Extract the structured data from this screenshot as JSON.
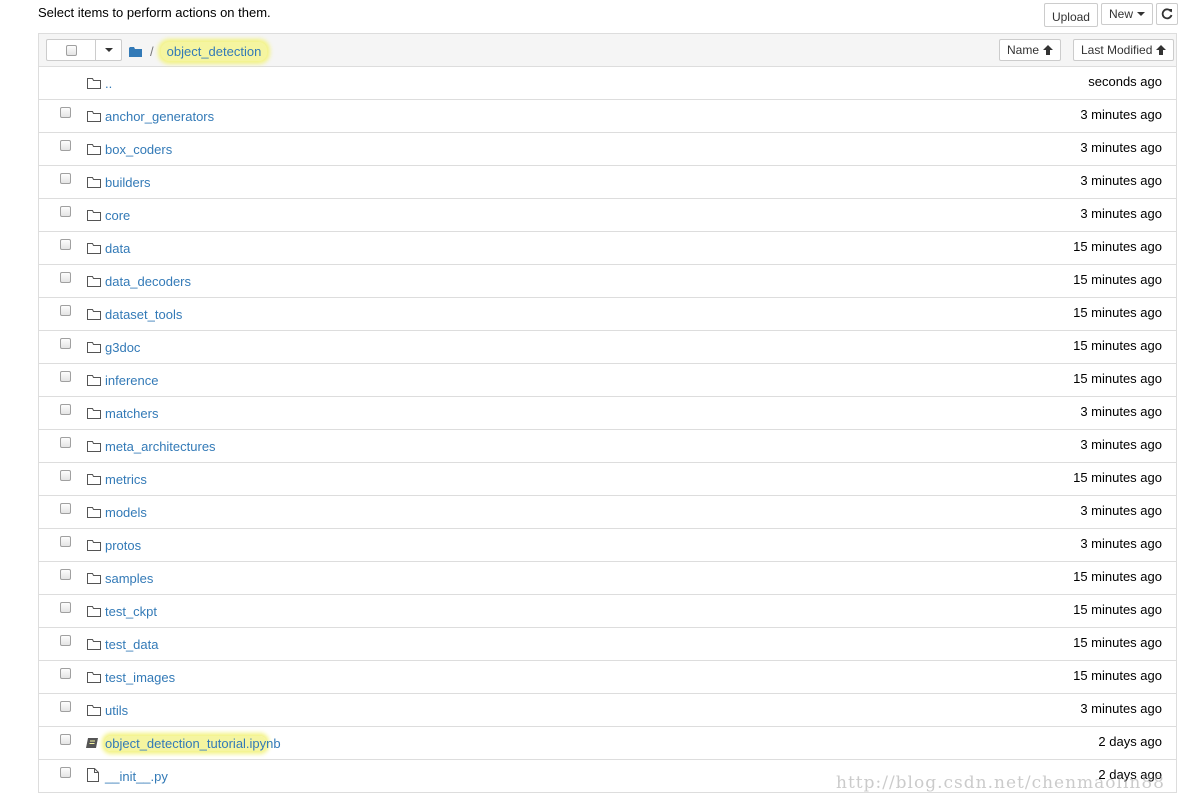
{
  "instructions": "Select items to perform actions on them.",
  "toolbar": {
    "upload_label": "Upload",
    "new_label": "New",
    "refresh_icon": "refresh-icon"
  },
  "header": {
    "breadcrumb_root_icon": "folder-icon",
    "breadcrumb_sep": "/",
    "breadcrumb_current": "object_detection",
    "sort_name_label": "Name",
    "sort_modified_label": "Last Modified"
  },
  "items": [
    {
      "name": "..",
      "time": "seconds ago",
      "type": "folder",
      "checkbox": false
    },
    {
      "name": "anchor_generators",
      "time": "3 minutes ago",
      "type": "folder",
      "checkbox": true
    },
    {
      "name": "box_coders",
      "time": "3 minutes ago",
      "type": "folder",
      "checkbox": true
    },
    {
      "name": "builders",
      "time": "3 minutes ago",
      "type": "folder",
      "checkbox": true
    },
    {
      "name": "core",
      "time": "3 minutes ago",
      "type": "folder",
      "checkbox": true
    },
    {
      "name": "data",
      "time": "15 minutes ago",
      "type": "folder",
      "checkbox": true
    },
    {
      "name": "data_decoders",
      "time": "15 minutes ago",
      "type": "folder",
      "checkbox": true
    },
    {
      "name": "dataset_tools",
      "time": "15 minutes ago",
      "type": "folder",
      "checkbox": true
    },
    {
      "name": "g3doc",
      "time": "15 minutes ago",
      "type": "folder",
      "checkbox": true
    },
    {
      "name": "inference",
      "time": "15 minutes ago",
      "type": "folder",
      "checkbox": true
    },
    {
      "name": "matchers",
      "time": "3 minutes ago",
      "type": "folder",
      "checkbox": true
    },
    {
      "name": "meta_architectures",
      "time": "3 minutes ago",
      "type": "folder",
      "checkbox": true
    },
    {
      "name": "metrics",
      "time": "15 minutes ago",
      "type": "folder",
      "checkbox": true
    },
    {
      "name": "models",
      "time": "3 minutes ago",
      "type": "folder",
      "checkbox": true
    },
    {
      "name": "protos",
      "time": "3 minutes ago",
      "type": "folder",
      "checkbox": true
    },
    {
      "name": "samples",
      "time": "15 minutes ago",
      "type": "folder",
      "checkbox": true
    },
    {
      "name": "test_ckpt",
      "time": "15 minutes ago",
      "type": "folder",
      "checkbox": true
    },
    {
      "name": "test_data",
      "time": "15 minutes ago",
      "type": "folder",
      "checkbox": true
    },
    {
      "name": "test_images",
      "time": "15 minutes ago",
      "type": "folder",
      "checkbox": true
    },
    {
      "name": "utils",
      "time": "3 minutes ago",
      "type": "folder",
      "checkbox": true
    },
    {
      "name": "object_detection_tutorial.ipynb",
      "time": "2 days ago",
      "type": "notebook",
      "checkbox": true,
      "highlight": true
    },
    {
      "name": "__init__.py",
      "time": "2 days ago",
      "type": "file",
      "checkbox": true
    }
  ],
  "watermark": "http://blog.csdn.net/chenmaolin88",
  "colors": {
    "link": "#337ab7",
    "highlight": "#f3f383",
    "header_bg": "#f5f5f5"
  }
}
